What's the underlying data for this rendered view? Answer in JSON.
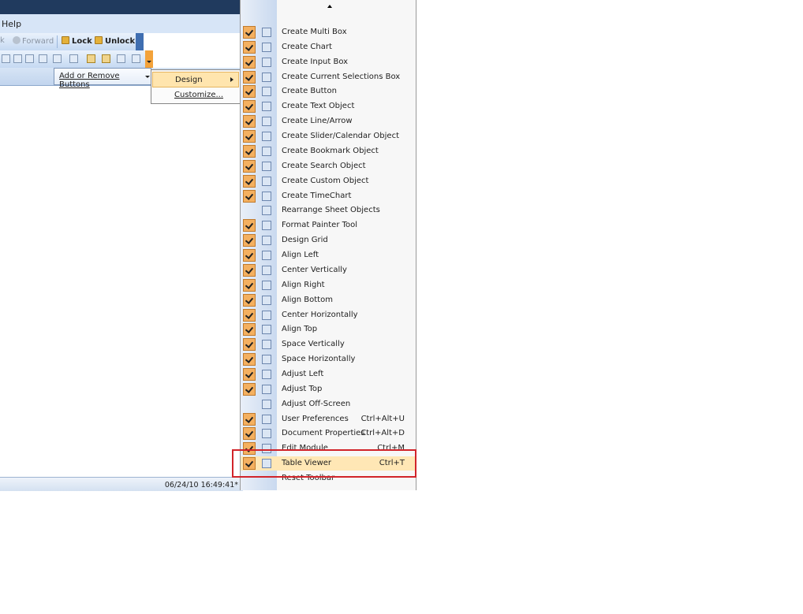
{
  "app": {
    "menu_help": "Help",
    "back_label": "k",
    "forward_label": "Forward",
    "lock_label": "Lock",
    "unlock_label": "Unlock",
    "add_remove_label": "Add or Remove Buttons",
    "submenu": [
      {
        "label": "Design",
        "highlighted": true
      },
      {
        "label": "Customize..."
      }
    ],
    "status_datetime": "06/24/10 16:49:41*"
  },
  "menu": {
    "items": [
      {
        "label": "Create Multi Box",
        "checked": true,
        "icon": "multi-box-icon"
      },
      {
        "label": "Create Chart",
        "checked": true,
        "icon": "chart-icon"
      },
      {
        "label": "Create Input Box",
        "checked": true,
        "icon": "input-box-icon"
      },
      {
        "label": "Create Current Selections Box",
        "checked": true,
        "icon": "current-selections-icon"
      },
      {
        "label": "Create Button",
        "checked": true,
        "icon": "button-icon"
      },
      {
        "label": "Create Text Object",
        "checked": true,
        "icon": "text-object-icon"
      },
      {
        "label": "Create Line/Arrow",
        "checked": true,
        "icon": "line-arrow-icon"
      },
      {
        "label": "Create Slider/Calendar Object",
        "checked": true,
        "icon": "slider-calendar-icon"
      },
      {
        "label": "Create Bookmark Object",
        "checked": true,
        "icon": "bookmark-icon"
      },
      {
        "label": "Create Search Object",
        "checked": true,
        "icon": "search-object-icon"
      },
      {
        "label": "Create Custom Object",
        "checked": true,
        "icon": "custom-object-icon"
      },
      {
        "label": "Create TimeChart",
        "checked": true,
        "icon": "timechart-icon"
      },
      {
        "label": "Rearrange Sheet Objects",
        "checked": false,
        "icon": "rearrange-icon"
      },
      {
        "label": "Format Painter Tool",
        "checked": true,
        "icon": "format-painter-icon"
      },
      {
        "label": "Design Grid",
        "checked": true,
        "icon": "design-grid-icon"
      },
      {
        "label": "Align Left",
        "checked": true,
        "icon": "align-left-icon"
      },
      {
        "label": "Center Vertically",
        "checked": true,
        "icon": "center-vertically-icon"
      },
      {
        "label": "Align Right",
        "checked": true,
        "icon": "align-right-icon"
      },
      {
        "label": "Align Bottom",
        "checked": true,
        "icon": "align-bottom-icon"
      },
      {
        "label": "Center Horizontally",
        "checked": true,
        "icon": "center-horizontally-icon"
      },
      {
        "label": "Align Top",
        "checked": true,
        "icon": "align-top-icon"
      },
      {
        "label": "Space Vertically",
        "checked": true,
        "icon": "space-vertically-icon"
      },
      {
        "label": "Space Horizontally",
        "checked": true,
        "icon": "space-horizontally-icon"
      },
      {
        "label": "Adjust Left",
        "checked": true,
        "icon": "adjust-left-icon"
      },
      {
        "label": "Adjust Top",
        "checked": true,
        "icon": "adjust-top-icon"
      },
      {
        "label": "Adjust Off-Screen",
        "checked": false,
        "icon": "adjust-offscreen-icon"
      },
      {
        "label": "User Preferences",
        "checked": true,
        "icon": "user-preferences-icon",
        "shortcut": "Ctrl+Alt+U"
      },
      {
        "label": "Document Properties",
        "checked": true,
        "icon": "document-properties-icon",
        "shortcut": "Ctrl+Alt+D"
      },
      {
        "label": "Edit Module",
        "checked": true,
        "icon": "edit-module-icon",
        "shortcut": "Ctrl+M"
      },
      {
        "label": "Table Viewer",
        "checked": true,
        "icon": "table-viewer-icon",
        "shortcut": "Ctrl+T",
        "highlighted": true
      },
      {
        "label": "Reset Toolbar",
        "checked": false,
        "icon": ""
      }
    ]
  },
  "colors": {
    "check_fill": "#f4b060",
    "highlight": "#ffe7b5",
    "annotation_red": "#d1242a",
    "toolbar_blue": "#c5d9f2"
  }
}
